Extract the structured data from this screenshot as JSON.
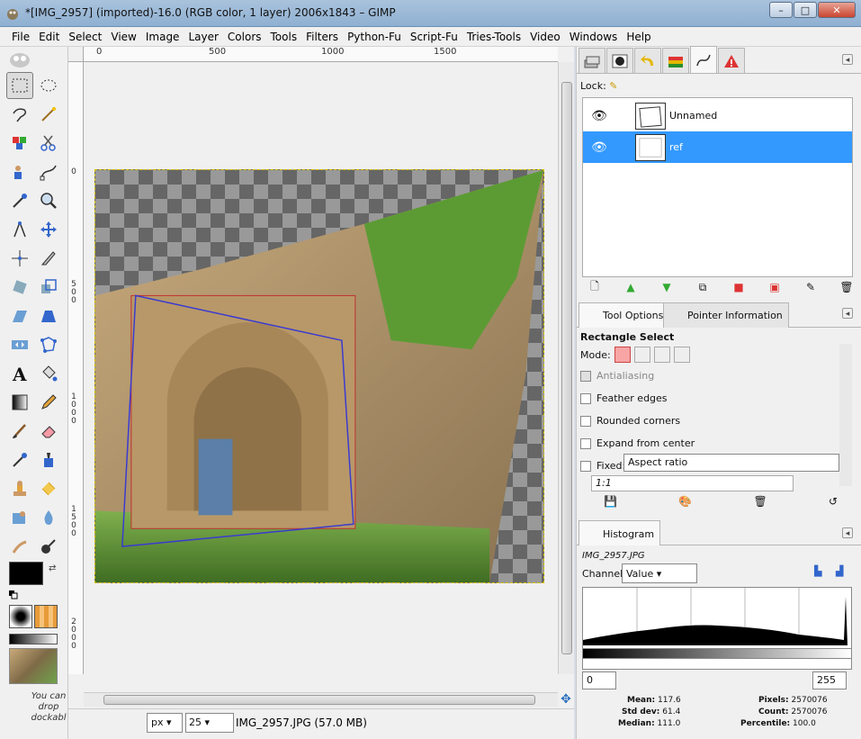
{
  "window": {
    "title": "*[IMG_2957] (imported)-16.0 (RGB color, 1 layer) 2006x1843 – GIMP",
    "min_glyph": "–",
    "max_glyph": "□",
    "close_glyph": "✕"
  },
  "menu": [
    "File",
    "Edit",
    "Select",
    "View",
    "Image",
    "Layer",
    "Colors",
    "Tools",
    "Filters",
    "Python-Fu",
    "Script-Fu",
    "Tries-Tools",
    "Video",
    "Windows",
    "Help"
  ],
  "toolbox": {
    "drop_text": "You can drop dockabl"
  },
  "rulers": {
    "h_ticks": [
      "0",
      "500",
      "1000",
      "1500"
    ],
    "v_ticks": [
      "0",
      "5 0 0",
      "1 0 0 0",
      "1 5 0 0",
      "2 0 0 0"
    ]
  },
  "status": {
    "unit": "px",
    "zoom": "25",
    "text": "IMG_2957.JPG (57.0 MB)"
  },
  "layers": {
    "lock_label": "Lock:",
    "items": [
      {
        "name": "Unnamed"
      },
      {
        "name": "ref"
      }
    ]
  },
  "tool_options": {
    "tabs": [
      "Tool Options",
      "Pointer Information"
    ],
    "title": "Rectangle Select",
    "mode_label": "Mode:",
    "options": [
      "Antialiasing",
      "Feather edges",
      "Rounded corners",
      "Expand from center"
    ],
    "fixed_label": "Fixed:",
    "fixed_value": "Aspect ratio",
    "ratio_value": "1:1"
  },
  "histogram": {
    "tab": "Histogram",
    "image_name": "IMG_2957.JPG",
    "channel_label": "Channel:",
    "channel_value": "Value",
    "range_min": "0",
    "range_max": "255",
    "stats": {
      "mean_label": "Mean:",
      "mean": "117.6",
      "stddev_label": "Std dev:",
      "stddev": "61.4",
      "median_label": "Median:",
      "median": "111.0",
      "pixels_label": "Pixels:",
      "pixels": "2570076",
      "count_label": "Count:",
      "count": "2570076",
      "percentile_label": "Percentile:",
      "percentile": "100.0"
    }
  },
  "colors": {
    "selection": "#3399ff",
    "titlebar": "#9ab7d6"
  }
}
